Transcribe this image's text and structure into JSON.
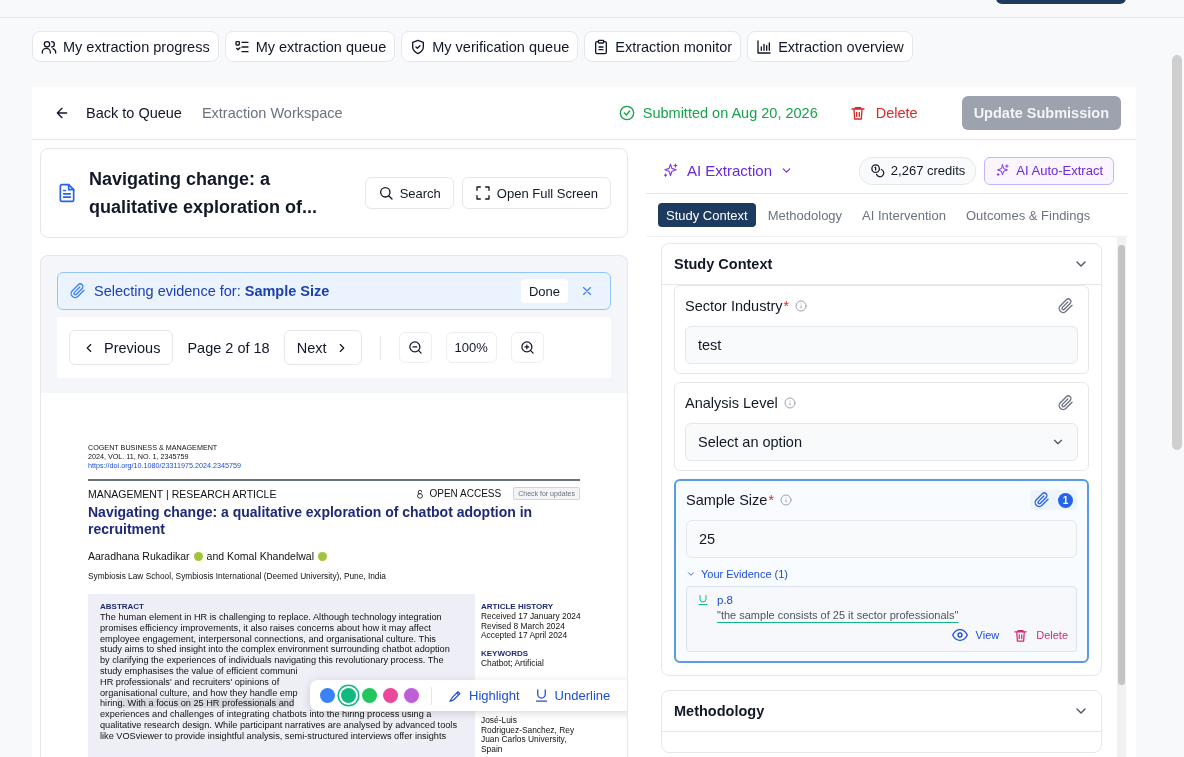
{
  "nav_tabs": [
    {
      "label": "My extraction progress"
    },
    {
      "label": "My extraction queue"
    },
    {
      "label": "My verification queue"
    },
    {
      "label": "Extraction monitor"
    },
    {
      "label": "Extraction overview"
    }
  ],
  "header": {
    "back": "Back to Queue",
    "breadcrumb": "Extraction Workspace",
    "status": "Submitted on Aug 20, 2026",
    "delete": "Delete",
    "update": {
      "label": "Update Submission",
      "disabled": true
    }
  },
  "document": {
    "title": "Navigating change: a qualitative exploration of...",
    "buttons": [
      "Search",
      "Open Full Screen"
    ]
  },
  "evidence_banner": {
    "text": "Selecting evidence for: **Sample Size**",
    "done": "Done"
  },
  "pager": {
    "previous": "Previous",
    "page": "Page 2 of 18",
    "next": "Next",
    "zoom": "100%"
  },
  "pdf": {
    "journal": [
      "COGENT BUSINESS & MANAGEMENT",
      "2024, VOL. 11, NO. 1, 2345759"
    ],
    "doi": "https://doi.org/10.1080/23311975.2024.2345759",
    "section": "MANAGEMENT | RESEARCH ARTICLE",
    "open_access": "OPEN ACCESS",
    "updates": "Check for updates",
    "title": "Navigating change: a qualitative exploration of chatbot adoption in recruitment",
    "authors": [
      "Aaradhana Rukadikar",
      "and Komal Khandelwal"
    ],
    "affiliation": "Symbiosis Law School, Symbiosis International (Deemed University), Pune, India",
    "abstract_heading": "ABSTRACT",
    "abstract_lines": [
      {
        "text": "The human element in HR is challenging to replace. Although technology integration"
      },
      {
        "text": "promises efficiency improvements, it also raises concerns about how it may affect"
      },
      {
        "text": "employee engagement, interpersonal connections, and organisational culture. This"
      },
      {
        "text": "study aims to shed insight into the complex environment surrounding chatbot adoption"
      },
      {
        "text": "by clarifying the experiences of individuals navigating this revolutionary process. The"
      },
      {
        "text": "study emphasises the value of efficient communi"
      },
      {
        "text": "HR professionals' and recruiters' opinions of"
      },
      {
        "text": "organisational culture, and how they handle emp"
      },
      {
        "text": "hirin",
        "marked": "g. With a focus on 25 HR professionals and"
      },
      {
        "text": "experiences and challenges of integrating chatbots into the hiring process using a"
      },
      {
        "text": "qualitative research design. While participant narratives are analysed by advanced tools"
      },
      {
        "text": "like VOSviewer to provide insightful analysis, semi-structured interviews offer insights"
      }
    ],
    "history_heading": "ARTICLE HISTORY",
    "history": [
      "Received 17 January 2024",
      "Revised 8 March 2024",
      "Accepted 17 April 2024"
    ],
    "keywords_heading": "KEYWORDS",
    "keywords": [
      "Chatbot; Artificial"
    ],
    "editor": [
      "José-Luis",
      "Rodriguez-Sanchez, Rey",
      "Juan Carlos University,",
      "Spain"
    ]
  },
  "highlight_toolbar": {
    "colors": [
      {
        "color": "#3b82f6",
        "selected": false
      },
      {
        "color": "#10b981",
        "selected": true
      },
      {
        "color": "#22c55e",
        "selected": false
      },
      {
        "color": "#ec4899",
        "selected": false
      },
      {
        "color": "#c05ed8",
        "selected": false
      }
    ],
    "highlight": "Highlight",
    "underline": "Underline"
  },
  "extraction": {
    "menu": "AI Extraction",
    "credits": "2,267 credits",
    "auto": "AI Auto-Extract",
    "tabs": [
      {
        "label": "Study Context",
        "selected": true
      },
      {
        "label": "Methodology",
        "selected": false
      },
      {
        "label": "AI Intervention",
        "selected": false
      },
      {
        "label": "Outcomes & Findings",
        "selected": false
      }
    ],
    "sections": [
      {
        "title": "Study Context",
        "expanded": true,
        "fields": [
          {
            "label": "Sector Industry",
            "required_mark": "*",
            "kind": "text",
            "value": "test",
            "active": false
          },
          {
            "label": "Analysis Level",
            "kind": "select",
            "placeholder": "Select an option",
            "active": false
          },
          {
            "label": "Sample Size",
            "required_mark": "*",
            "kind": "text",
            "value": "25",
            "active": true,
            "evidence_count": "1",
            "evidence": {
              "toggle": "Your Evidence (1)",
              "expanded": true,
              "items": [
                {
                  "page": "p.8",
                  "quote": "\"the sample consists of 25 it sector professionals\"",
                  "view": "View",
                  "delete": "Delete"
                }
              ]
            }
          }
        ]
      },
      {
        "title": "Methodology",
        "expanded": true
      }
    ]
  }
}
